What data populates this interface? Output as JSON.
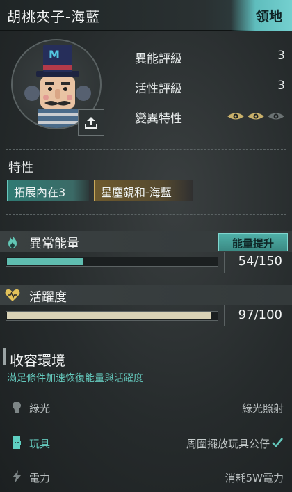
{
  "header": {
    "title": "胡桃夾子-海藍",
    "territory_button": "領地"
  },
  "stats": {
    "ability_rating_label": "異能評級",
    "ability_rating_value": "3",
    "activity_rating_label": "活性評級",
    "activity_rating_value": "3",
    "mutation_label": "變異特性",
    "mutation_eyes": 3,
    "mutation_eyes_active": 2
  },
  "traits": {
    "label": "特性",
    "items": [
      "拓展內在3",
      "星塵親和-海藍"
    ]
  },
  "energy": {
    "label": "異常能量",
    "boost_button": "能量提升",
    "value_text": "54/150",
    "current": 54,
    "max": 150,
    "color": "#5fbdb0"
  },
  "vitality": {
    "label": "活躍度",
    "value_text": "97/100",
    "current": 97,
    "max": 100,
    "color": "#d9d2b6"
  },
  "environment": {
    "title": "收容環境",
    "description": "滿足條件加速恢復能量與活躍度",
    "rows": [
      {
        "icon": "lightbulb-icon",
        "label": "綠光",
        "value": "綠光照射",
        "met": false
      },
      {
        "icon": "toy-icon",
        "label": "玩具",
        "value": "周圍擺放玩具公仔",
        "met": true
      },
      {
        "icon": "lightning-icon",
        "label": "電力",
        "value": "消耗5W電力",
        "met": false
      }
    ]
  },
  "colors": {
    "accent": "#64c8bc",
    "gold": "#c8a85a"
  }
}
